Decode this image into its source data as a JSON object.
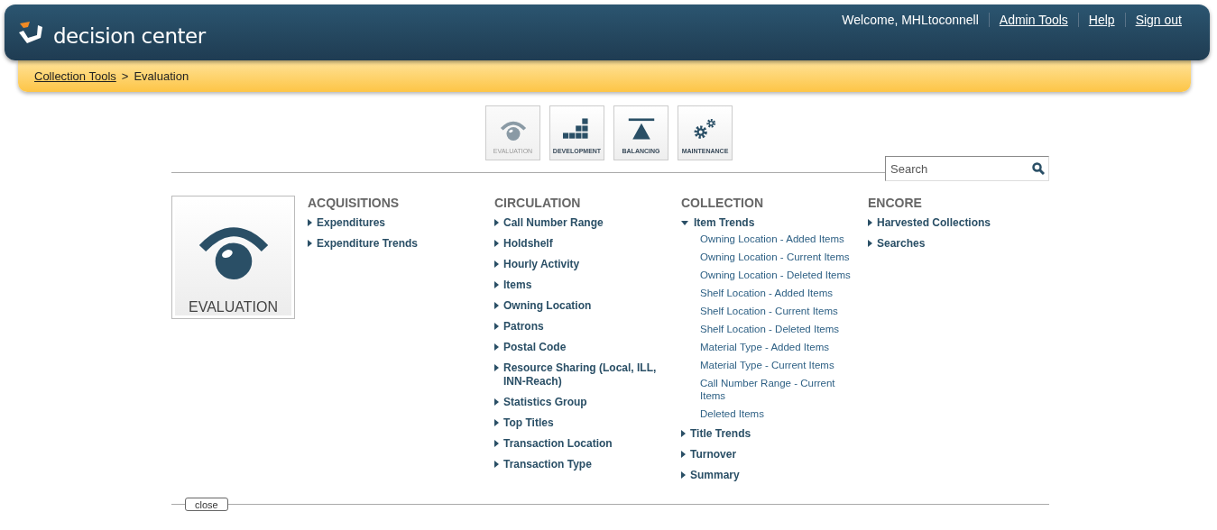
{
  "header": {
    "logo_text": "decision center",
    "welcome": "Welcome, MHLtoconnell",
    "links": [
      "Admin Tools",
      "Help",
      "Sign out"
    ]
  },
  "breadcrumb": {
    "link": "Collection Tools",
    "separator": ">",
    "current": "Evaluation"
  },
  "tools": [
    {
      "label": "EVALUATION",
      "kind": "eye",
      "selected": true
    },
    {
      "label": "DEVELOPMENT",
      "kind": "blocks",
      "selected": false
    },
    {
      "label": "BALANCING",
      "kind": "balance",
      "selected": false
    },
    {
      "label": "MAINTENANCE",
      "kind": "gears",
      "selected": false
    }
  ],
  "search": {
    "placeholder": "Search"
  },
  "featured": {
    "label": "EVALUATION",
    "kind": "eye"
  },
  "columns": [
    {
      "heading": "ACQUISITIONS",
      "items": [
        {
          "label": "Expenditures",
          "expanded": false
        },
        {
          "label": "Expenditure Trends",
          "expanded": false
        }
      ]
    },
    {
      "heading": "CIRCULATION",
      "items": [
        {
          "label": "Call Number Range",
          "expanded": false
        },
        {
          "label": "Holdshelf",
          "expanded": false
        },
        {
          "label": "Hourly Activity",
          "expanded": false
        },
        {
          "label": "Items",
          "expanded": false
        },
        {
          "label": "Owning Location",
          "expanded": false
        },
        {
          "label": "Patrons",
          "expanded": false
        },
        {
          "label": "Postal Code",
          "expanded": false
        },
        {
          "label": "Resource Sharing (Local, ILL, INN-Reach)",
          "expanded": false
        },
        {
          "label": "Statistics Group",
          "expanded": false
        },
        {
          "label": "Top Titles",
          "expanded": false
        },
        {
          "label": "Transaction Location",
          "expanded": false
        },
        {
          "label": "Transaction Type",
          "expanded": false
        }
      ]
    },
    {
      "heading": "COLLECTION",
      "items": [
        {
          "label": "Item Trends",
          "expanded": true,
          "children": [
            "Owning Location - Added Items",
            "Owning Location - Current Items",
            "Owning Location - Deleted Items",
            "Shelf Location - Added Items",
            "Shelf Location - Current Items",
            "Shelf Location - Deleted Items",
            "Material Type - Added Items",
            "Material Type - Current Items",
            "Call Number Range - Current Items",
            "Deleted Items"
          ]
        },
        {
          "label": "Title Trends",
          "expanded": false
        },
        {
          "label": "Turnover",
          "expanded": false
        },
        {
          "label": "Summary",
          "expanded": false
        }
      ]
    },
    {
      "heading": "ENCORE",
      "items": [
        {
          "label": "Harvested Collections",
          "expanded": false
        },
        {
          "label": "Searches",
          "expanded": false
        }
      ]
    }
  ],
  "close_button": "close"
}
